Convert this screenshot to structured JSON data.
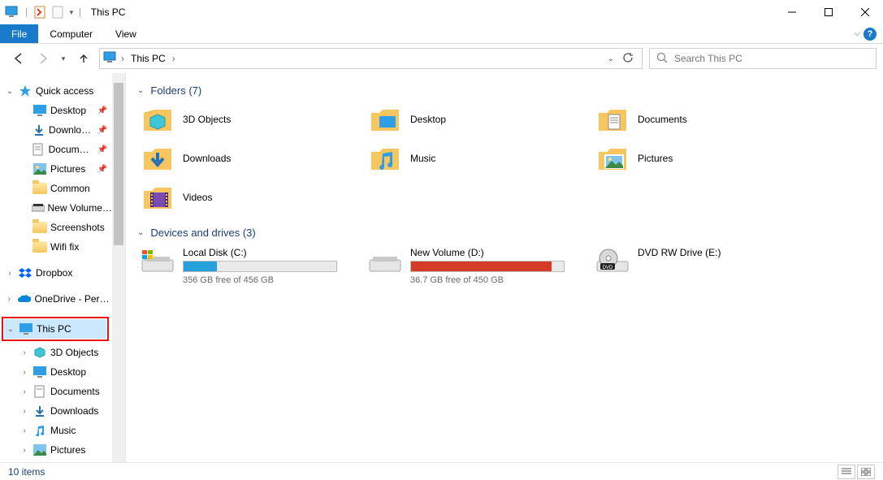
{
  "window": {
    "title": "This PC"
  },
  "ribbon": {
    "file": "File",
    "tabs": [
      "Computer",
      "View"
    ]
  },
  "breadcrumb": {
    "root": "This PC"
  },
  "search": {
    "placeholder": "Search This PC"
  },
  "sidebar": {
    "quick_access": {
      "label": "Quick access",
      "items": [
        {
          "label": "Desktop",
          "pinned": true
        },
        {
          "label": "Downloads",
          "pinned": true
        },
        {
          "label": "Documents",
          "pinned": true
        },
        {
          "label": "Pictures",
          "pinned": true
        },
        {
          "label": "Common"
        },
        {
          "label": "New Volume (D:)"
        },
        {
          "label": "Screenshots"
        },
        {
          "label": "Wifi fix"
        }
      ]
    },
    "dropbox": {
      "label": "Dropbox"
    },
    "onedrive": {
      "label": "OneDrive - Personal"
    },
    "this_pc": {
      "label": "This PC",
      "children": [
        {
          "label": "3D Objects"
        },
        {
          "label": "Desktop"
        },
        {
          "label": "Documents"
        },
        {
          "label": "Downloads"
        },
        {
          "label": "Music"
        },
        {
          "label": "Pictures"
        }
      ]
    }
  },
  "groups": {
    "folders": {
      "title": "Folders (7)",
      "items": [
        {
          "label": "3D Objects"
        },
        {
          "label": "Desktop"
        },
        {
          "label": "Documents"
        },
        {
          "label": "Downloads"
        },
        {
          "label": "Music"
        },
        {
          "label": "Pictures"
        },
        {
          "label": "Videos"
        }
      ]
    },
    "drives": {
      "title": "Devices and drives (3)",
      "items": [
        {
          "label": "Local Disk (C:)",
          "sub": "356 GB free of 456 GB",
          "fill_pct": 22,
          "color": "#26a0da"
        },
        {
          "label": "New Volume (D:)",
          "sub": "36.7 GB free of 450 GB",
          "fill_pct": 92,
          "color": "#d63b28"
        },
        {
          "label": "DVD RW Drive (E:)",
          "sub": "",
          "fill_pct": 0,
          "color": ""
        }
      ]
    }
  },
  "status": {
    "text": "10 items"
  }
}
